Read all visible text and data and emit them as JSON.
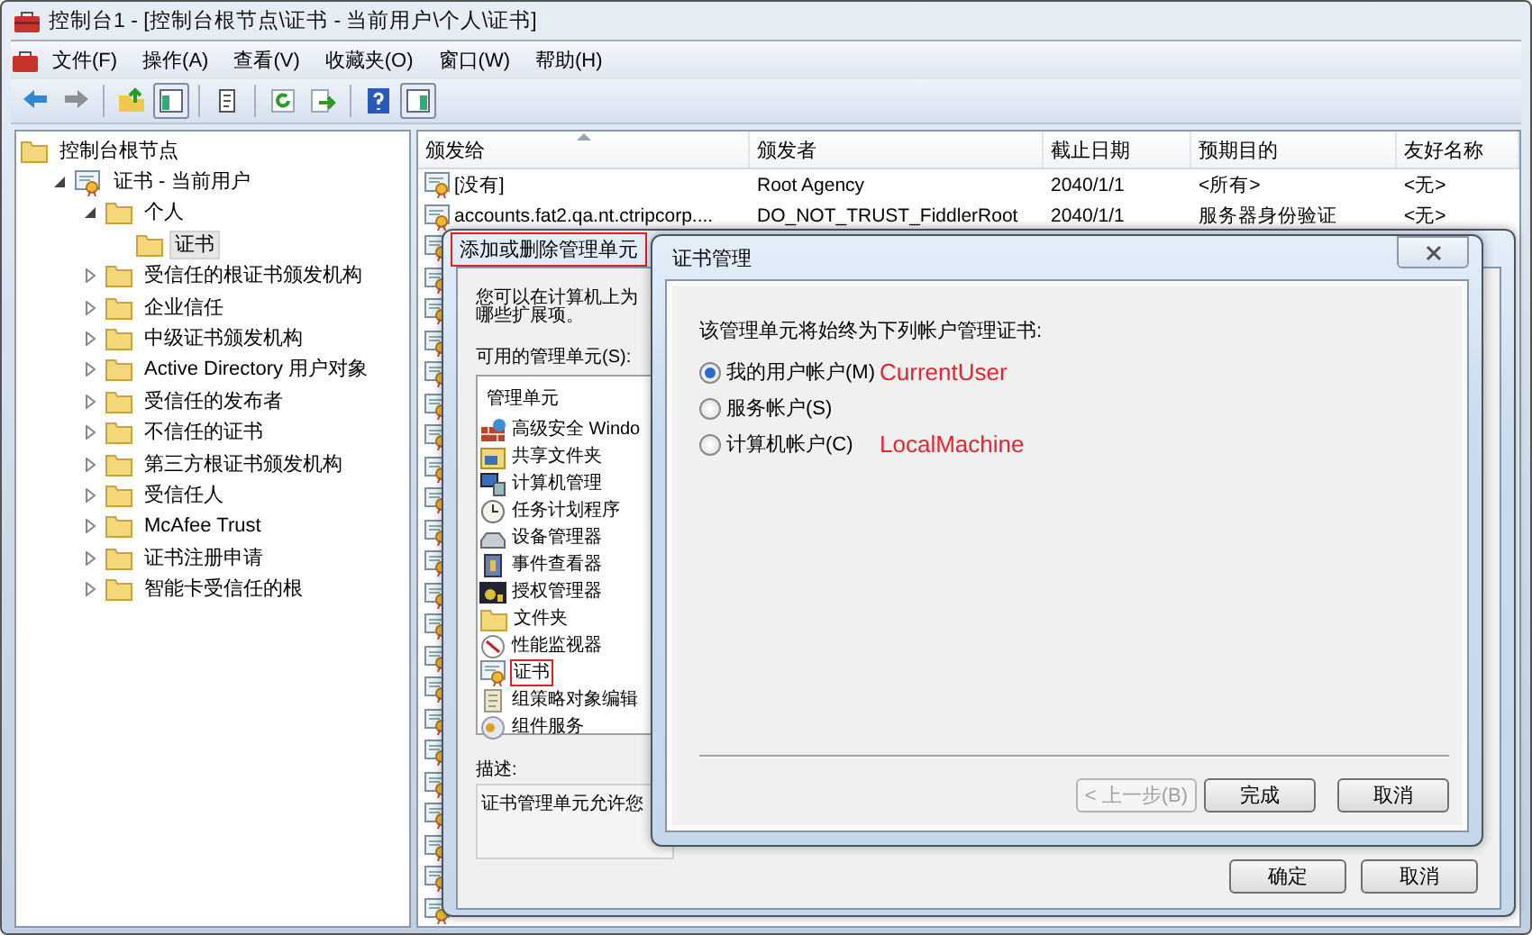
{
  "window": {
    "title": "控制台1 - [控制台根节点\\证书 - 当前用户\\个人\\证书]"
  },
  "menu": [
    "文件(F)",
    "操作(A)",
    "查看(V)",
    "收藏夹(O)",
    "窗口(W)",
    "帮助(H)"
  ],
  "toolbar": [
    {
      "kind": "back",
      "pressed": false
    },
    {
      "kind": "forward",
      "pressed": false
    },
    {
      "kind": "separator"
    },
    {
      "kind": "up",
      "pressed": false
    },
    {
      "kind": "tree",
      "pressed": true
    },
    {
      "kind": "separator"
    },
    {
      "kind": "properties",
      "pressed": false
    },
    {
      "kind": "separator"
    },
    {
      "kind": "refresh",
      "pressed": false
    },
    {
      "kind": "export",
      "pressed": false
    },
    {
      "kind": "separator"
    },
    {
      "kind": "help",
      "pressed": false
    },
    {
      "kind": "actions",
      "pressed": true
    }
  ],
  "tree": {
    "label": "控制台根节点",
    "kind": "folder",
    "selected": false,
    "children": [
      {
        "label": "证书 - 当前用户",
        "kind": "cert",
        "expanded": true,
        "selected": false,
        "children": [
          {
            "label": "个人",
            "kind": "folder",
            "expanded": true,
            "selected": false,
            "children": [
              {
                "label": "证书",
                "kind": "folder",
                "selected": true
              }
            ]
          },
          {
            "label": "受信任的根证书颁发机构",
            "kind": "folder",
            "expanded": false,
            "selected": false
          },
          {
            "label": "企业信任",
            "kind": "folder",
            "expanded": false,
            "selected": false
          },
          {
            "label": "中级证书颁发机构",
            "kind": "folder",
            "expanded": false,
            "selected": false
          },
          {
            "label": "Active Directory 用户对象",
            "kind": "folder",
            "expanded": false,
            "selected": false
          },
          {
            "label": "受信任的发布者",
            "kind": "folder",
            "expanded": false,
            "selected": false
          },
          {
            "label": "不信任的证书",
            "kind": "folder",
            "expanded": false,
            "selected": false
          },
          {
            "label": "第三方根证书颁发机构",
            "kind": "folder",
            "expanded": false,
            "selected": false
          },
          {
            "label": "受信任人",
            "kind": "folder",
            "expanded": false,
            "selected": false
          },
          {
            "label": "McAfee Trust",
            "kind": "folder",
            "expanded": false,
            "selected": false
          },
          {
            "label": "证书注册申请",
            "kind": "folder",
            "expanded": false,
            "selected": false
          },
          {
            "label": "智能卡受信任的根",
            "kind": "folder",
            "expanded": false,
            "selected": false
          }
        ]
      }
    ]
  },
  "list": {
    "columns": [
      {
        "label": "颁发给",
        "sorted": true
      },
      {
        "label": "颁发者",
        "sorted": false
      },
      {
        "label": "截止日期",
        "sorted": false
      },
      {
        "label": "预期目的",
        "sorted": false
      },
      {
        "label": "友好名称",
        "sorted": false
      }
    ],
    "rows": [
      {
        "kind": "cert",
        "cells": [
          "[没有]",
          "Root Agency",
          "2040/1/1",
          "<所有>",
          "<无>"
        ]
      },
      {
        "kind": "cert",
        "cells": [
          "accounts.fat2.qa.nt.ctripcorp....",
          "DO_NOT_TRUST_FiddlerRoot",
          "2040/1/1",
          "服务器身份验证",
          "<无>"
        ]
      },
      {
        "kind": "covered"
      },
      {
        "kind": "covered"
      },
      {
        "kind": "covered"
      },
      {
        "kind": "covered"
      },
      {
        "kind": "covered"
      },
      {
        "kind": "covered"
      },
      {
        "kind": "covered"
      },
      {
        "kind": "covered"
      },
      {
        "kind": "covered"
      },
      {
        "kind": "covered"
      },
      {
        "kind": "covered"
      },
      {
        "kind": "covered"
      },
      {
        "kind": "covered"
      },
      {
        "kind": "covered"
      },
      {
        "kind": "covered"
      },
      {
        "kind": "covered"
      },
      {
        "kind": "covered"
      },
      {
        "kind": "covered"
      },
      {
        "kind": "covered"
      },
      {
        "kind": "covered"
      },
      {
        "kind": "covered"
      },
      {
        "kind": "covered"
      }
    ]
  },
  "snapin_dialog": {
    "title": "添加或删除管理单元",
    "title_highlighted": true,
    "intro": "您可以在计算机上为",
    "intro_line_2": "哪些扩展项。",
    "available_label": "可用的管理单元(S):",
    "list_header": "管理单元",
    "snapins": [
      {
        "label": "高级安全 Windo",
        "kind": "firewall",
        "highlighted": false
      },
      {
        "label": "共享文件夹",
        "kind": "share",
        "highlighted": false
      },
      {
        "label": "计算机管理",
        "kind": "computer",
        "highlighted": false
      },
      {
        "label": "任务计划程序",
        "kind": "clock",
        "highlighted": false
      },
      {
        "label": "设备管理器",
        "kind": "device",
        "highlighted": false
      },
      {
        "label": "事件查看器",
        "kind": "event",
        "highlighted": false
      },
      {
        "label": "授权管理器",
        "kind": "auth",
        "highlighted": false
      },
      {
        "label": "文件夹",
        "kind": "folder",
        "highlighted": false
      },
      {
        "label": "性能监视器",
        "kind": "perf",
        "highlighted": false
      },
      {
        "label": "证书",
        "kind": "cert",
        "highlighted": true
      },
      {
        "label": "组策略对象编辑",
        "kind": "policy",
        "highlighted": false
      },
      {
        "label": "组件服务",
        "kind": "component",
        "highlighted": false
      }
    ],
    "description_label": "描述:",
    "description": "证书管理单元允许您",
    "buttons": [
      {
        "label": "确定"
      },
      {
        "label": "取消"
      }
    ]
  },
  "cert_dialog": {
    "title": "证书管理",
    "prompt": "该管理单元将始终为下列帐户管理证书:",
    "options": [
      {
        "label": "我的用户帐户(M)",
        "selected": true,
        "note": "CurrentUser"
      },
      {
        "label": "服务帐户(S)",
        "selected": false
      },
      {
        "label": "计算机帐户(C)",
        "selected": false,
        "note": "LocalMachine"
      }
    ],
    "buttons": [
      {
        "label": "< 上一步(B)",
        "disabled": true
      },
      {
        "label": "完成",
        "disabled": false
      },
      {
        "label": "取消",
        "disabled": false
      }
    ]
  }
}
